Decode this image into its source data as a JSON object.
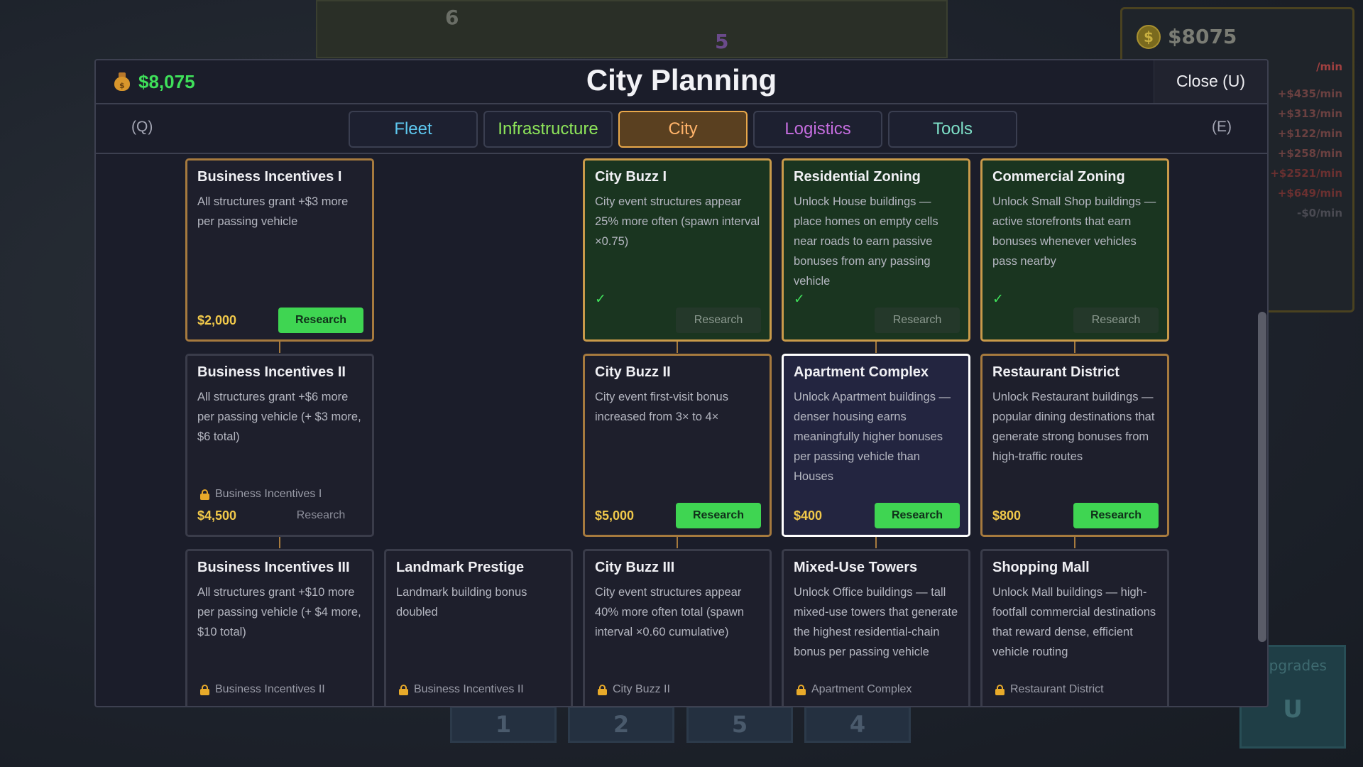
{
  "background": {
    "grid_numbers": [
      "6",
      "5"
    ],
    "money_coin": "$",
    "money_amount": "$8075",
    "rates": [
      {
        "text": "/min",
        "color": "#a04040"
      },
      {
        "text": "+$435/min",
        "color": "#6a4040"
      },
      {
        "text": "+$313/min",
        "color": "#6a4040"
      },
      {
        "text": "+$122/min",
        "color": "#6a4040"
      },
      {
        "text": "+$258/min",
        "color": "#6a4040"
      },
      {
        "text": "+$2521/min",
        "color": "#6a3030"
      },
      {
        "text": "+$649/min",
        "color": "#6a3030"
      },
      {
        "text": "-$0/min",
        "color": "#4a4a52"
      }
    ],
    "hotbar": [
      "1",
      "2",
      "5",
      "4"
    ],
    "upgrades_label": "Upgrades",
    "upgrades_key": "U"
  },
  "header": {
    "money": "$8,075",
    "title": "City Planning",
    "close_label": "Close  (U)"
  },
  "tabs": {
    "prev_key": "(Q)",
    "next_key": "(E)",
    "items": [
      {
        "label": "Fleet",
        "color": "#5ec8f0"
      },
      {
        "label": "Infrastructure",
        "color": "#8ee65a"
      },
      {
        "label": "City",
        "color": "#ffb36a"
      },
      {
        "label": "Logistics",
        "color": "#c66ee0"
      },
      {
        "label": "Tools",
        "color": "#7ee0c8"
      }
    ],
    "active_index": 2
  },
  "research_label": "Research",
  "checkmark": "✓",
  "cards": [
    {
      "name": "Business Incentives I",
      "desc": "All structures grant +$3 more per passing vehicle",
      "price": "$2,000",
      "state": "avail"
    },
    {
      "name": "City Buzz I",
      "desc": "City event structures appear 25% more often (spawn interval ×0.75)",
      "state": "owned"
    },
    {
      "name": "Residential Zoning",
      "desc": "Unlock House buildings — place homes on empty cells near roads to earn passive bonuses from any passing vehicle",
      "state": "owned"
    },
    {
      "name": "Commercial Zoning",
      "desc": "Unlock Small Shop buildings — active storefronts that earn bonuses whenever vehicles pass nearby",
      "state": "owned"
    },
    {
      "name": "Business Incentives II",
      "desc": "All structures grant +$6 more per passing vehicle (+ $3 more, $6 total)",
      "price": "$4,500",
      "requires": "Business Incentives I",
      "state": "locked"
    },
    {
      "name": "City Buzz II",
      "desc": "City event first-visit bonus increased from 3× to 4×",
      "price": "$5,000",
      "state": "avail"
    },
    {
      "name": "Apartment Complex",
      "desc": "Unlock Apartment buildings — denser housing earns meaningfully higher bonuses per passing vehicle than Houses",
      "price": "$400",
      "state": "selected"
    },
    {
      "name": "Restaurant District",
      "desc": "Unlock Restaurant buildings — popular dining destinations that generate strong bonuses from high-traffic routes",
      "price": "$800",
      "state": "avail"
    },
    {
      "name": "Business Incentives III",
      "desc": "All structures grant +$10 more per passing vehicle (+ $4 more, $10 total)",
      "requires": "Business Incentives II",
      "state": "locked"
    },
    {
      "name": "Landmark Prestige",
      "desc": "Landmark building bonus doubled",
      "requires": "Business Incentives II",
      "state": "locked"
    },
    {
      "name": "City Buzz III",
      "desc": "City event structures appear 40% more often total (spawn interval ×0.60 cumulative)",
      "requires": "City Buzz II",
      "state": "locked"
    },
    {
      "name": "Mixed-Use Towers",
      "desc": "Unlock Office buildings — tall mixed-use towers that generate the highest residential-chain bonus per passing vehicle",
      "requires": "Apartment Complex",
      "state": "locked"
    },
    {
      "name": "Shopping Mall",
      "desc": "Unlock Mall buildings — high-footfall commercial destinations that reward dense, efficient vehicle routing",
      "requires": "Restaurant District",
      "state": "locked"
    }
  ]
}
